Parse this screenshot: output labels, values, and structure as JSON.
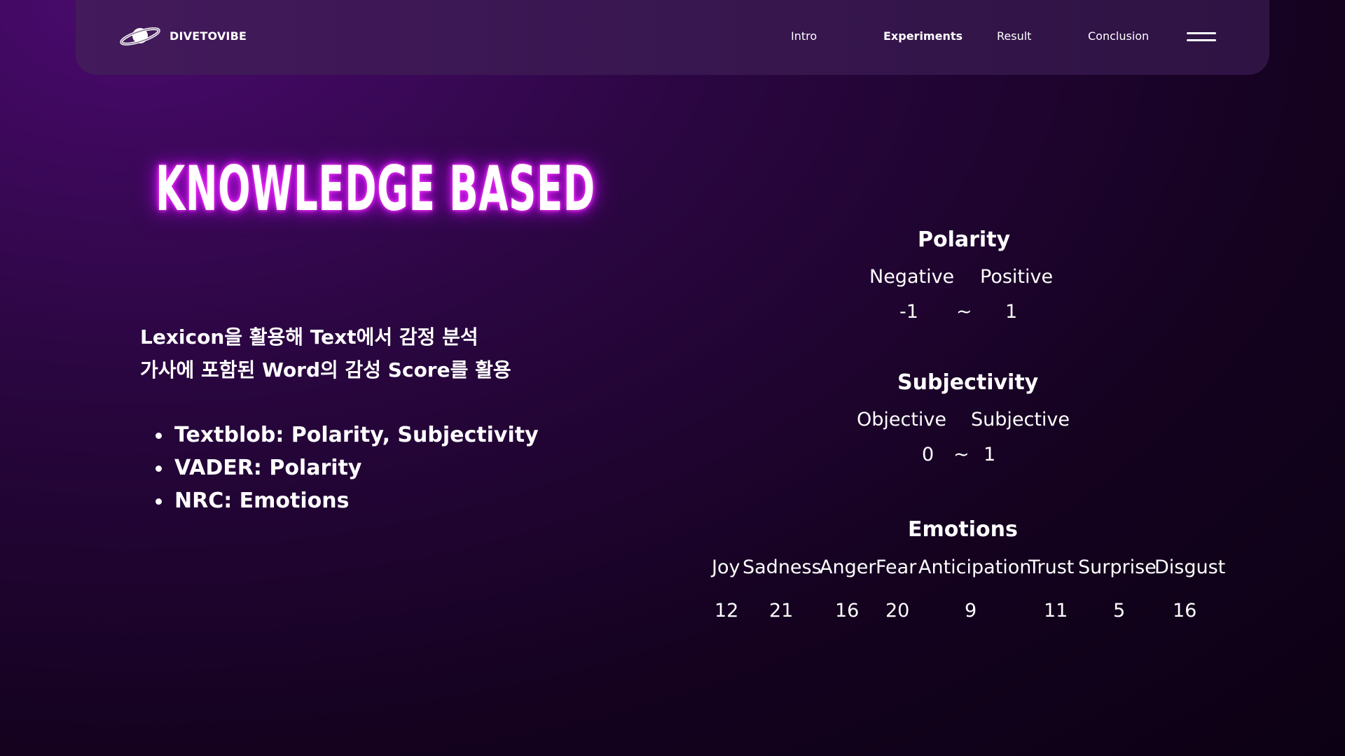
{
  "nav": {
    "brand": "DIVETOVIBE",
    "links": [
      "Intro",
      "Experiments",
      "Result",
      "Conclusion"
    ],
    "active": "Experiments"
  },
  "headline": "KNOWLEDGE BASED",
  "description": [
    "Lexicon을 활용해 Text에서 감정 분석",
    "가사에 포함된 Word의 감성 Score를 활용"
  ],
  "bullets": [
    "Textblob: Polarity, Subjectivity",
    "VADER: Polarity",
    "NRC: Emotions"
  ],
  "polarity": {
    "title": "Polarity",
    "labels": [
      "Negative",
      "Positive"
    ],
    "min": "-1",
    "sep": "~",
    "max": "1"
  },
  "subjectivity": {
    "title": "Subjectivity",
    "labels": [
      "Objective",
      "Subjective"
    ],
    "min": "0",
    "sep": "~",
    "max": "1"
  },
  "emotions": {
    "title": "Emotions",
    "labels": [
      "Joy",
      "Sadness",
      "Anger",
      "Fear",
      "Anticipation",
      "Trust",
      "Surprise",
      "Disgust"
    ],
    "values": [
      "12",
      "21",
      "16",
      "20",
      "9",
      "11",
      "5",
      "16"
    ]
  },
  "colors": {
    "glow": "#e21cff",
    "nav_bg": "#431a5c",
    "bg_dark": "#14021f"
  }
}
